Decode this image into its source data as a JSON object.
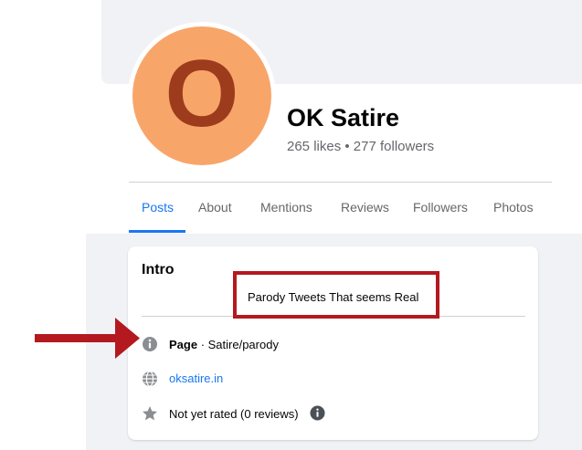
{
  "profile": {
    "avatar_letter": "O",
    "name": "OK Satire",
    "stats": "265 likes • 277 followers"
  },
  "tabs": [
    {
      "label": "Posts",
      "active": true
    },
    {
      "label": "About"
    },
    {
      "label": "Mentions"
    },
    {
      "label": "Reviews"
    },
    {
      "label": "Followers"
    },
    {
      "label": "Photos"
    }
  ],
  "intro": {
    "title": "Intro",
    "bio": "Parody Tweets That seems Real",
    "page_label": "Page",
    "page_category": " · Satire/parody",
    "website": "oksatire.in",
    "rating": "Not yet rated (0 reviews)"
  },
  "icons": {
    "info": "info-icon",
    "globe": "globe-icon",
    "star": "star-icon",
    "arrow": "red-arrow-annotation",
    "box": "red-highlight-box"
  },
  "colors": {
    "accent": "#1877f2",
    "avatar_bg": "#f8a56a",
    "avatar_letter": "#9c3c1d",
    "annotation": "#b3191f"
  }
}
